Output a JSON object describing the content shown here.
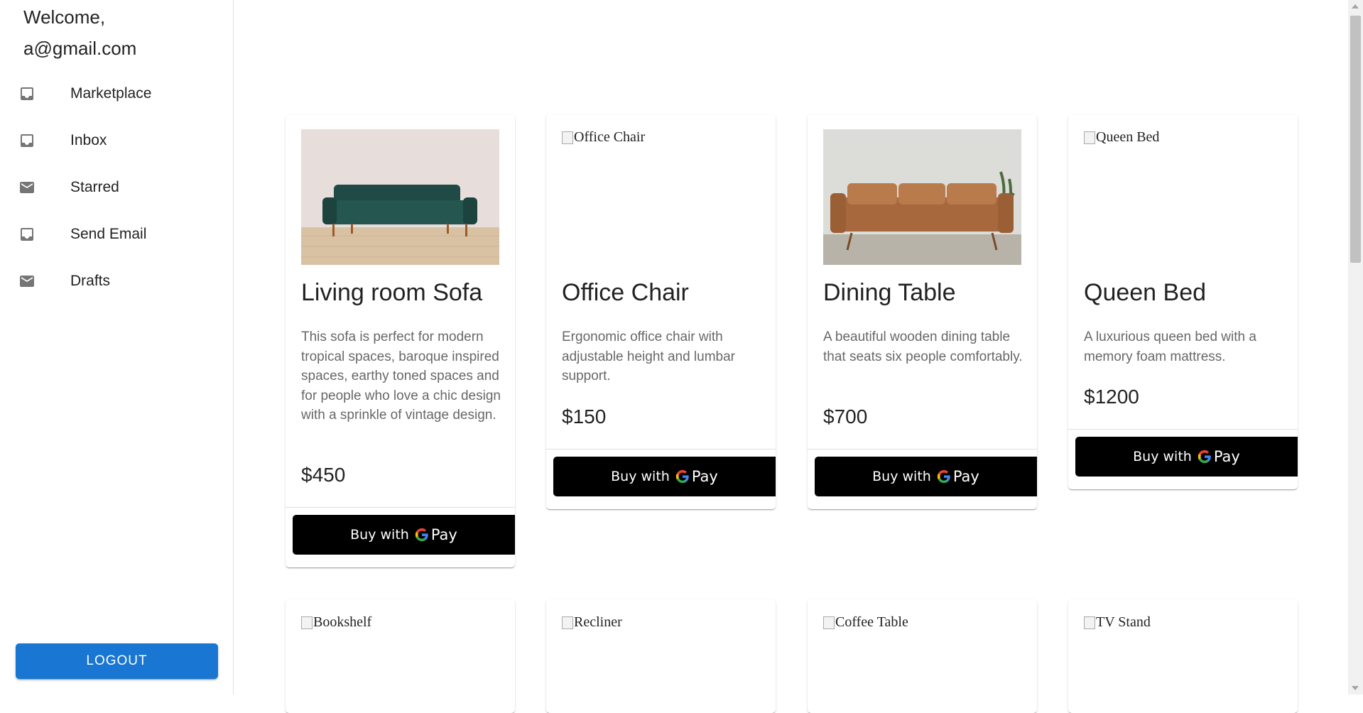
{
  "sidebar": {
    "welcome_line1": "Welcome,",
    "welcome_line2": "a@gmail.com",
    "items": [
      {
        "label": "Marketplace",
        "icon": "inbox-icon"
      },
      {
        "label": "Inbox",
        "icon": "inbox-icon"
      },
      {
        "label": "Starred",
        "icon": "mail-icon"
      },
      {
        "label": "Send Email",
        "icon": "inbox-icon"
      },
      {
        "label": "Drafts",
        "icon": "mail-icon"
      }
    ],
    "logout_label": "LOGOUT"
  },
  "products": [
    {
      "title": "Living room Sofa",
      "description": "This sofa is perfect for modern tropical spaces, baroque inspired spaces, earthy toned spaces and for people who love a chic design with a sprinkle of vintage design.",
      "price": "$450",
      "image_alt": "Living room Sofa",
      "image_loaded": true
    },
    {
      "title": "Office Chair",
      "description": "Ergonomic office chair with adjustable height and lumbar support.",
      "price": "$150",
      "image_alt": "Office Chair",
      "image_loaded": false
    },
    {
      "title": "Dining Table",
      "description": "A beautiful wooden dining table that seats six people comfortably.",
      "price": "$700",
      "image_alt": "Dining Table",
      "image_loaded": true
    },
    {
      "title": "Queen Bed",
      "description": "A luxurious queen bed with a memory foam mattress.",
      "price": "$1200",
      "image_alt": "Queen Bed",
      "image_loaded": false
    },
    {
      "image_alt": "Bookshelf",
      "image_loaded": false
    },
    {
      "image_alt": "Recliner",
      "image_loaded": false
    },
    {
      "image_alt": "Coffee Table",
      "image_loaded": false
    },
    {
      "image_alt": "TV Stand",
      "image_loaded": false
    }
  ],
  "gpay": {
    "buy_with": "Buy with",
    "pay": "Pay"
  },
  "colors": {
    "accent": "#1976d2",
    "gpay_bg": "#000000"
  }
}
